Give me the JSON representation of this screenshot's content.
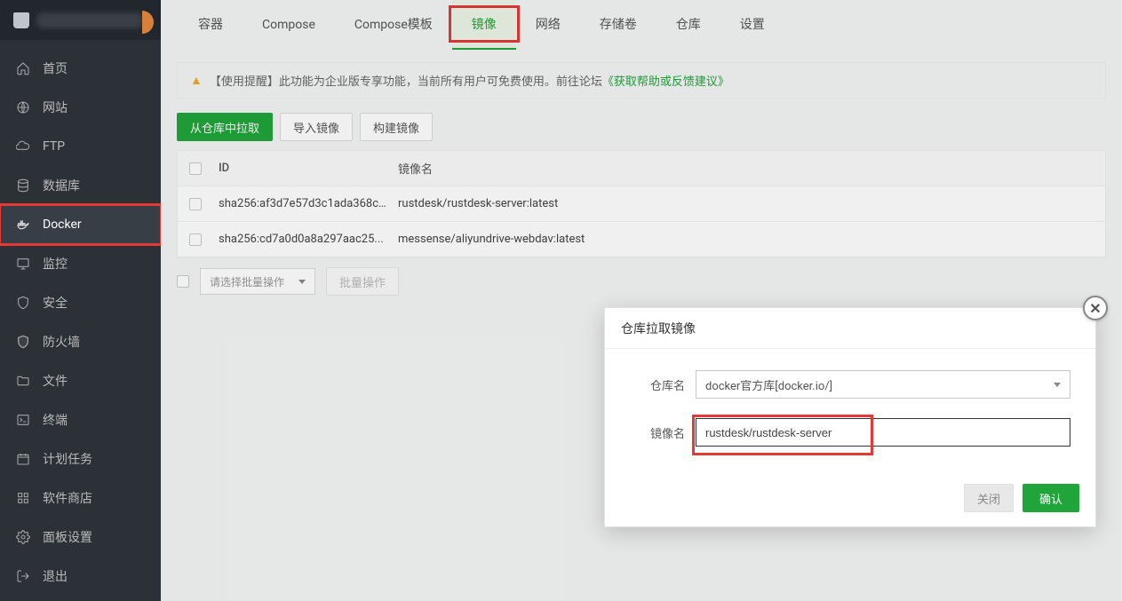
{
  "sidebar": {
    "items": [
      {
        "label": "首页",
        "icon": "home"
      },
      {
        "label": "网站",
        "icon": "globe"
      },
      {
        "label": "FTP",
        "icon": "ftp"
      },
      {
        "label": "数据库",
        "icon": "database"
      },
      {
        "label": "Docker",
        "icon": "docker"
      },
      {
        "label": "监控",
        "icon": "monitor"
      },
      {
        "label": "安全",
        "icon": "shield"
      },
      {
        "label": "防火墙",
        "icon": "firewall"
      },
      {
        "label": "文件",
        "icon": "folder"
      },
      {
        "label": "终端",
        "icon": "terminal"
      },
      {
        "label": "计划任务",
        "icon": "calendar"
      },
      {
        "label": "软件商店",
        "icon": "apps"
      },
      {
        "label": "面板设置",
        "icon": "settings"
      },
      {
        "label": "退出",
        "icon": "logout"
      }
    ]
  },
  "tabs": [
    {
      "label": "容器"
    },
    {
      "label": "Compose"
    },
    {
      "label": "Compose模板"
    },
    {
      "label": "镜像"
    },
    {
      "label": "网络"
    },
    {
      "label": "存储卷"
    },
    {
      "label": "仓库"
    },
    {
      "label": "设置"
    }
  ],
  "alert": {
    "prefix": "【使用提醒】此功能为企业版专享功能，当前所有用户可免费使用。前往论坛",
    "link": "《获取帮助或反馈建议》"
  },
  "toolbar": {
    "pull": "从仓库中拉取",
    "import": "导入镜像",
    "build": "构建镜像"
  },
  "table": {
    "headers": {
      "id": "ID",
      "name": "镜像名"
    },
    "rows": [
      {
        "id": "sha256:af3d7e57d3c1ada368c...",
        "name": "rustdesk/rustdesk-server:latest"
      },
      {
        "id": "sha256:cd7a0d0a8a297aac25...",
        "name": "messense/aliyundrive-webdav:latest"
      }
    ],
    "batch_placeholder": "请选择批量操作",
    "batch_action": "批量操作"
  },
  "modal": {
    "title": "仓库拉取镜像",
    "repo_label": "仓库名",
    "repo_value": "docker官方库[docker.io/]",
    "image_label": "镜像名",
    "image_value": "rustdesk/rustdesk-server",
    "close_label": "关闭",
    "confirm_label": "确认"
  }
}
